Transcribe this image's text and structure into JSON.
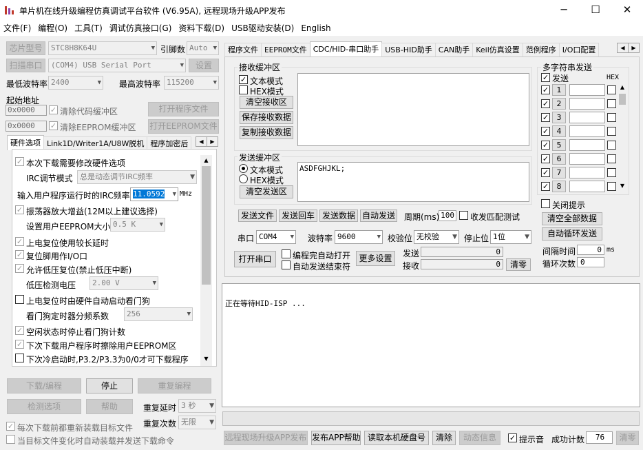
{
  "window": {
    "title": "单片机在线升级编程仿真调试平台软件 (V6.95A), 远程现场升级APP发布",
    "minimize": "─",
    "maximize": "☐",
    "close": "✕"
  },
  "menu": [
    "文件(F)",
    "编程(O)",
    "工具(T)",
    "调试仿真接口(G)",
    "资料下载(D)",
    "USB驱动安装(D)",
    "English"
  ],
  "left": {
    "chip_label": "芯片型号",
    "chip_value": "STC8H8K64U",
    "pins_label": "引脚数",
    "pins_value": "Auto",
    "scan_label": "扫描串口",
    "port_value": "(COM4) USB Serial Port",
    "settings_label": "设置",
    "min_baud_label": "最低波特率",
    "min_baud_value": "2400",
    "max_baud_label": "最高波特率",
    "max_baud_value": "115200",
    "start_addr_label": "起始地址",
    "addr1": "0x0000",
    "clear_code": "清除代码缓冲区",
    "open_prog": "打开程序文件",
    "addr2": "0x0000",
    "clear_eeprom": "清除EEPROM缓冲区",
    "open_eeprom": "打开EEPROM文件",
    "tabs": [
      "硬件选项",
      "Link1D/Writer1A/U8W脱机",
      "程序加密后"
    ],
    "hw_options": {
      "modify": "本次下载需要修改硬件选项",
      "irc_mode_label": "IRC调节模式",
      "irc_mode_value": "总是动态调节IRC频率",
      "irc_freq_label": "输入用户程序运行时的IRC频率",
      "irc_freq_value": "11.0592",
      "irc_unit": "MHz",
      "osc_gain": "振荡器放大增益(12M以上建议选择)",
      "eeprom_size_label": "设置用户EEPROM大小",
      "eeprom_size_value": "0.5 K",
      "long_delay": "上电复位使用较长延时",
      "reset_io": "复位脚用作I/O口",
      "lvd_reset": "允许低压复位(禁止低压中断)",
      "lvd_label": "低压检测电压",
      "lvd_value": "2.00 V",
      "wdt_hw": "上电复位时由硬件自动启动看门狗",
      "wdt_div_label": "看门狗定时器分频系数",
      "wdt_div_value": "256",
      "wdt_idle": "空闲状态时停止看门狗计数",
      "erase_eeprom": "下次下载用户程序时擦除用户EEPROM区",
      "p32p33": "下次冷启动时,P3.2/P3.3为0/0才可下载程序"
    },
    "download": "下载/编程",
    "stop": "停止",
    "reprogram": "重复编程",
    "check": "检测选项",
    "help": "帮助",
    "repeat_delay_label": "重复延时",
    "repeat_delay_value": "3 秒",
    "repeat_count_label": "重复次数",
    "repeat_count_value": "无限",
    "reload_each": "每次下载前都重新装载目标文件",
    "auto_send": "当目标文件变化时自动装载并发送下载命令"
  },
  "right": {
    "tabs": [
      "程序文件",
      "EEPROM文件",
      "CDC/HID-串口助手",
      "USB-HID助手",
      "CAN助手",
      "Keil仿真设置",
      "范例程序",
      "I/O口配置"
    ],
    "recv": {
      "group": "接收缓冲区",
      "text_mode": "文本模式",
      "hex_mode": "HEX模式",
      "clear": "清空接收区",
      "save": "保存接收数据",
      "copy": "复制接收数据"
    },
    "send": {
      "group": "发送缓冲区",
      "text_mode": "文本模式",
      "hex_mode": "HEX模式",
      "clear": "清空发送区",
      "content": "ASDFGHJKL;"
    },
    "actions": {
      "send_file": "发送文件",
      "send_cr": "发送回车",
      "send_data": "发送数据",
      "auto_send": "自动发送",
      "period_label": "周期(ms)",
      "period_value": "100",
      "match": "收发匹配测试"
    },
    "port": {
      "port_label": "串口",
      "port_value": "COM4",
      "baud_label": "波特率",
      "baud_value": "9600",
      "parity_label": "校验位",
      "parity_value": "无校验",
      "stop_label": "停止位",
      "stop_value": "1位"
    },
    "ctrl": {
      "open_port": "打开串口",
      "auto_open": "编程完自动打开",
      "auto_end": "自动发送结束符",
      "more": "更多设置",
      "send_label": "发送",
      "send_count": "0",
      "recv_label": "接收",
      "recv_count": "0",
      "clear_count": "清零"
    },
    "multi": {
      "group": "多字符串发送",
      "send_hdr": "发送",
      "hex_hdr": "HEX",
      "rows": [
        "1",
        "2",
        "3",
        "4",
        "5",
        "6",
        "7",
        "8"
      ],
      "close_tip": "关闭提示",
      "clear_all": "清空全部数据",
      "auto_loop": "自动循环发送",
      "interval_label": "间隔时间",
      "interval_value": "0",
      "interval_unit": "ms",
      "loop_label": "循环次数",
      "loop_value": "0"
    },
    "log": "正在等待HID-ISP ...",
    "bottom": {
      "remote": "远程现场升级APP发布",
      "help": "发布APP帮助",
      "read_disk": "读取本机硬盘号",
      "clear": "清除",
      "anim": "动态信息",
      "beep": "提示音",
      "success_label": "成功计数",
      "success_value": "76",
      "zero": "清零"
    }
  }
}
